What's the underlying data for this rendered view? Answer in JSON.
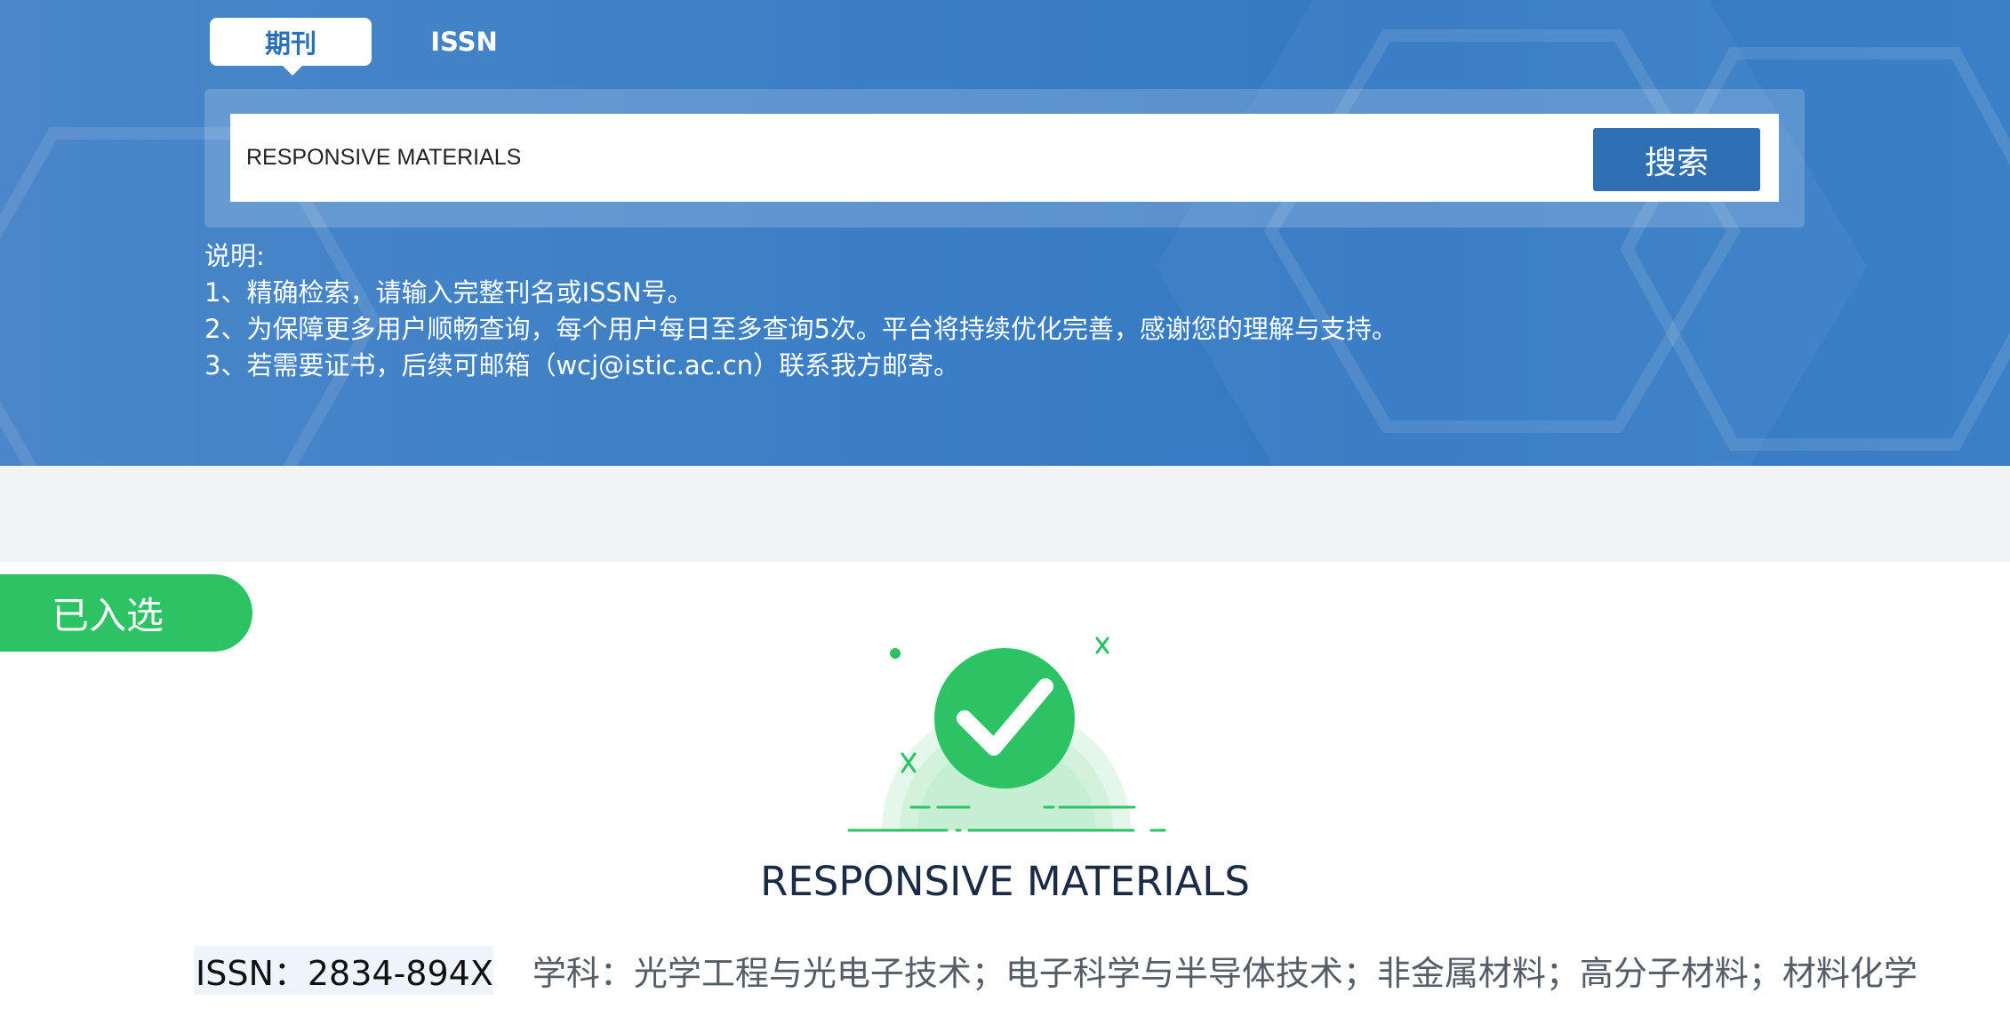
{
  "tabs": [
    {
      "label": "期刊",
      "active": true
    },
    {
      "label": "ISSN",
      "active": false
    }
  ],
  "search": {
    "value": "RESPONSIVE MATERIALS",
    "button_label": "搜索"
  },
  "notes": {
    "heading": "说明:",
    "lines": [
      "1、精确检索，请输入完整刊名或ISSN号。",
      "2、为保障更多用户顺畅查询，每个用户每日至多查询5次。平台将持续优化完善，感谢您的理解与支持。",
      "3、若需要证书，后续可邮箱（wcj@istic.ac.cn）联系我方邮寄。"
    ]
  },
  "result": {
    "status_badge": "已入选",
    "title": "RESPONSIVE MATERIALS",
    "issn": "ISSN：2834-894X",
    "subjects": "学科：光学工程与光电子技术；电子科学与半导体技术；非金属材料；高分子材料；材料化学"
  },
  "colors": {
    "banner": "#3a7dc5",
    "search_button": "#2f6fb3",
    "status_green": "#2cc364"
  }
}
